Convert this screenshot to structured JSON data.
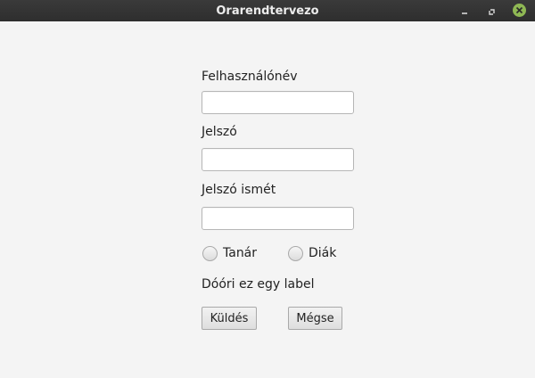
{
  "window": {
    "title": "Orarendtervezo"
  },
  "form": {
    "username_label": "Felhasználónév",
    "username_value": "",
    "password_label": "Jelszó",
    "password_value": "",
    "password_repeat_label": "Jelszó ismét",
    "password_repeat_value": "",
    "role_options": [
      "Tanár",
      "Diák"
    ],
    "info_label": "Dóóri ez egy label",
    "submit_label": "Küldés",
    "cancel_label": "Mégse"
  },
  "icons": {
    "minimize": "minimize-icon",
    "maximize": "maximize-icon",
    "close": "close-icon"
  },
  "colors": {
    "titlebar": "#2f2f2f",
    "close_button": "#8fb854",
    "window_background": "#f4f4f4"
  }
}
